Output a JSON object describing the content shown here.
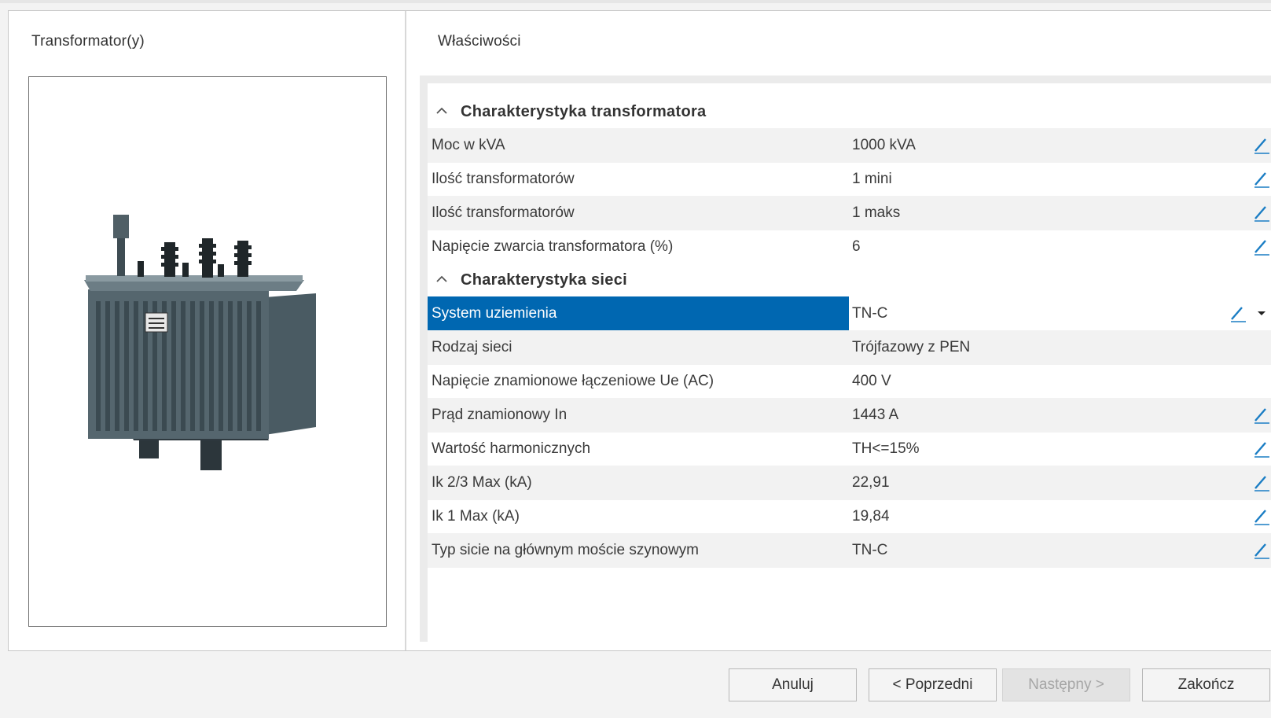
{
  "left_panel": {
    "title": "Transformator(y)",
    "image_alt": "Transformer image"
  },
  "right_panel": {
    "title": "Właściwości"
  },
  "sections": [
    {
      "title": "Charakterystyka transformatora",
      "rows": [
        {
          "name": "Moc w kVA",
          "value": "1000 kVA",
          "editable": true
        },
        {
          "name": "Ilość transformatorów",
          "value": "1 mini",
          "editable": true
        },
        {
          "name": "Ilość transformatorów",
          "value": "1 maks",
          "editable": true
        },
        {
          "name": "Napięcie zwarcia transformatora (%)",
          "value": "6",
          "editable": true
        }
      ]
    },
    {
      "title": "Charakterystyka sieci",
      "rows": [
        {
          "name": "System uziemienia",
          "value": "TN-C",
          "editable": true,
          "selected": true,
          "dropdown": true
        },
        {
          "name": "Rodzaj sieci",
          "value": "Trójfazowy z PEN",
          "editable": false
        },
        {
          "name": "Napięcie znamionowe łączeniowe Ue (AC)",
          "value": "400 V",
          "editable": false
        },
        {
          "name": "Prąd znamionowy In",
          "value": "1443 A",
          "editable": true
        },
        {
          "name": "Wartość harmonicznych",
          "value": "TH<=15%",
          "editable": true
        },
        {
          "name": "Ik 2/3 Max (kA)",
          "value": "22,91",
          "editable": true
        },
        {
          "name": "Ik 1 Max (kA)",
          "value": "19,84",
          "editable": true
        },
        {
          "name": "Typ sicie na głównym moście szynowym",
          "value": "TN-C",
          "editable": true
        }
      ]
    }
  ],
  "buttons": {
    "cancel": "Anuluj",
    "previous": "< Poprzedni",
    "next": "Następny >",
    "finish": "Zakończ"
  },
  "colors": {
    "selection": "#0067b1",
    "edit_icon": "#1a7dc4",
    "alt_row": "#f2f2f2"
  },
  "icons": {
    "edit": "pencil-icon",
    "collapse": "chevron-up-icon",
    "dropdown": "caret-down-icon"
  }
}
